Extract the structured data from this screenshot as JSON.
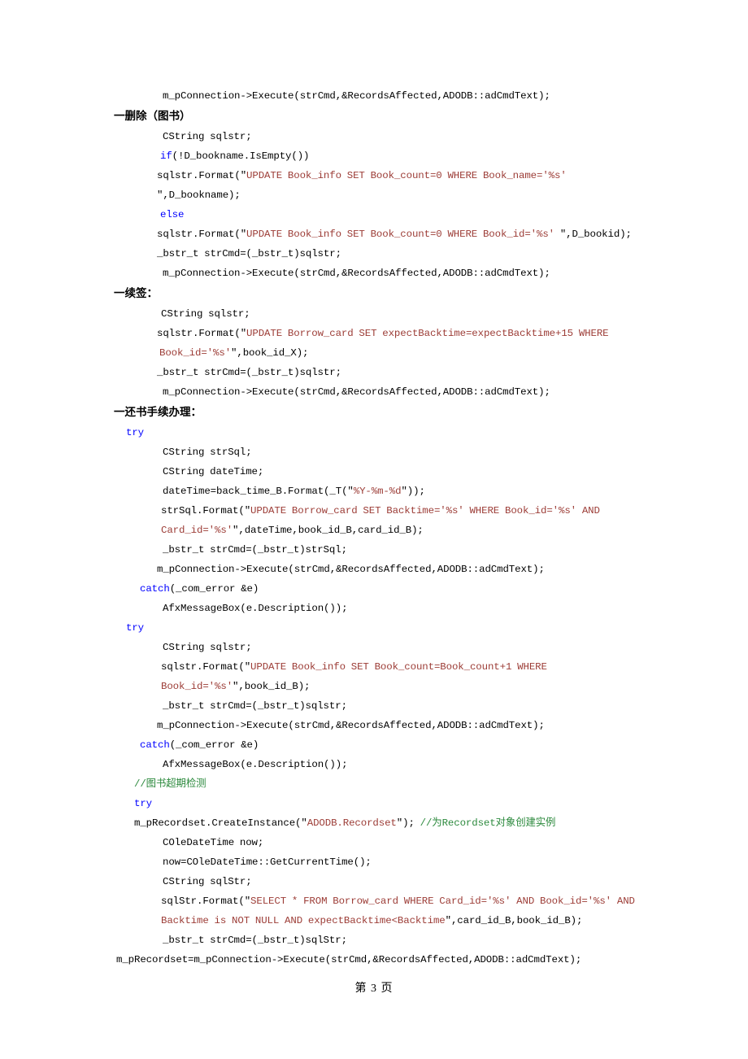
{
  "document": {
    "page_footer": "第 3 页",
    "colors": {
      "keyword": "#0000ff",
      "sql_string": "#9c3c36",
      "comment": "#2d8a3e",
      "text": "#000000"
    }
  },
  "lines": [
    {
      "id": "l01",
      "indent": "i-code",
      "segments": [
        {
          "text": "m_pConnection->Execute(strCmd,&RecordsAffected,ADODB::adCmdText);",
          "style": "plain"
        }
      ]
    },
    {
      "id": "h01",
      "type": "heading",
      "text": "一删除（图书）"
    },
    {
      "id": "l02",
      "indent": "i-code",
      "segments": [
        {
          "text": "CString sqlstr;",
          "style": "plain"
        }
      ]
    },
    {
      "id": "l03",
      "indent": "i-if",
      "segments": [
        {
          "text": "if",
          "style": "kw"
        },
        {
          "text": "(!D_bookname.IsEmpty())",
          "style": "plain"
        }
      ]
    },
    {
      "id": "l04",
      "indent": "i-sql",
      "segments": [
        {
          "text": "sqlstr.Format(″",
          "style": "plain"
        },
        {
          "text": "UPDATE Book_info SET Book_count=0 WHERE Book_name='%s'",
          "style": "sql"
        },
        {
          "text": " ″,D_bookname);",
          "style": "plain"
        }
      ]
    },
    {
      "id": "l05",
      "indent": "i-if",
      "segments": [
        {
          "text": "else",
          "style": "kw"
        }
      ]
    },
    {
      "id": "l06",
      "indent": "i-sql",
      "segments": [
        {
          "text": "sqlstr.Format(″",
          "style": "plain"
        },
        {
          "text": "UPDATE Book_info SET Book_count=0 WHERE Book_id='%s'",
          "style": "sql"
        },
        {
          "text": " ″,D_bookid);",
          "style": "plain"
        }
      ]
    },
    {
      "id": "l07",
      "indent": "i-sql",
      "segments": [
        {
          "text": "_bstr_t strCmd=(_bstr_t)sqlstr;",
          "style": "plain"
        }
      ]
    },
    {
      "id": "l08",
      "indent": "i-code",
      "segments": [
        {
          "text": "m_pConnection->Execute(strCmd,&RecordsAffected,ADODB::adCmdText);",
          "style": "plain"
        }
      ]
    },
    {
      "id": "h02",
      "type": "heading",
      "text": "一续签："
    },
    {
      "id": "l09",
      "indent": "i-fmt",
      "segments": [
        {
          "text": "CString sqlstr;",
          "style": "plain"
        }
      ]
    },
    {
      "id": "l10",
      "indent": "i-sql",
      "segments": [
        {
          "text": "sqlstr.Format(″",
          "style": "plain"
        },
        {
          "text": "UPDATE Borrow_card SET expectBacktime=expectBacktime+15 WHERE",
          "style": "sql"
        }
      ]
    },
    {
      "id": "l11",
      "indent": "i-cont",
      "segments": [
        {
          "text": "Book_id='%s'",
          "style": "sql"
        },
        {
          "text": "″,book_id_X);",
          "style": "plain"
        }
      ]
    },
    {
      "id": "l12",
      "indent": "i-sql",
      "segments": [
        {
          "text": "_bstr_t strCmd=(_bstr_t)sqlstr;",
          "style": "plain"
        }
      ]
    },
    {
      "id": "l13",
      "indent": "i-code",
      "segments": [
        {
          "text": "m_pConnection->Execute(strCmd,&RecordsAffected,ADODB::adCmdText);",
          "style": "plain"
        }
      ]
    },
    {
      "id": "h03",
      "type": "heading",
      "text": "一还书手续办理："
    },
    {
      "id": "l14",
      "indent": "i-try",
      "segments": [
        {
          "text": "try",
          "style": "kw"
        }
      ]
    },
    {
      "id": "l15",
      "indent": "i-code",
      "segments": [
        {
          "text": "CString strSql;",
          "style": "plain"
        }
      ]
    },
    {
      "id": "l16",
      "indent": "i-code",
      "segments": [
        {
          "text": "CString dateTime;",
          "style": "plain"
        }
      ]
    },
    {
      "id": "l17",
      "indent": "i-code",
      "segments": [
        {
          "text": "dateTime=back_time_B.Format(_T(″",
          "style": "plain"
        },
        {
          "text": "%Y-%m-%d",
          "style": "sql"
        },
        {
          "text": "″));",
          "style": "plain"
        }
      ]
    },
    {
      "id": "l18",
      "indent": "i-fmt",
      "segments": [
        {
          "text": "strSql.Format(″",
          "style": "plain"
        },
        {
          "text": "UPDATE Borrow_card SET Backtime='%s' WHERE Book_id='%s' AND",
          "style": "sql"
        }
      ]
    },
    {
      "id": "l19",
      "indent": "i-fmt",
      "segments": [
        {
          "text": "Card_id='%s'",
          "style": "sql"
        },
        {
          "text": "″,dateTime,book_id_B,card_id_B);",
          "style": "plain"
        }
      ]
    },
    {
      "id": "l20",
      "indent": "i-code",
      "segments": [
        {
          "text": "_bstr_t strCmd=(_bstr_t)strSql;",
          "style": "plain"
        }
      ]
    },
    {
      "id": "l21",
      "indent": "i-sql",
      "segments": [
        {
          "text": "m_pConnection->Execute(strCmd,&RecordsAffected,ADODB::adCmdText);",
          "style": "plain"
        }
      ]
    },
    {
      "id": "l22",
      "indent": "i-catch",
      "segments": [
        {
          "text": "catch",
          "style": "kw"
        },
        {
          "text": "(_com_error &e)",
          "style": "plain"
        }
      ]
    },
    {
      "id": "l23",
      "indent": "i-code",
      "segments": [
        {
          "text": "AfxMessageBox(e.Description());",
          "style": "plain"
        }
      ]
    },
    {
      "id": "l24",
      "indent": "i-try",
      "segments": [
        {
          "text": "try",
          "style": "kw"
        }
      ]
    },
    {
      "id": "l25",
      "indent": "i-code",
      "segments": [
        {
          "text": "CString sqlstr;",
          "style": "plain"
        }
      ]
    },
    {
      "id": "l26",
      "indent": "i-fmt",
      "segments": [
        {
          "text": "sqlstr.Format(″",
          "style": "plain"
        },
        {
          "text": "UPDATE Book_info SET Book_count=Book_count+1 WHERE",
          "style": "sql"
        }
      ]
    },
    {
      "id": "l27",
      "indent": "i-fmt",
      "segments": [
        {
          "text": "Book_id='%s'",
          "style": "sql"
        },
        {
          "text": "″,book_id_B);",
          "style": "plain"
        }
      ]
    },
    {
      "id": "l28",
      "indent": "i-code",
      "segments": [
        {
          "text": "_bstr_t strCmd=(_bstr_t)sqlstr;",
          "style": "plain"
        }
      ]
    },
    {
      "id": "l29",
      "indent": "i-sql",
      "segments": [
        {
          "text": "m_pConnection->Execute(strCmd,&RecordsAffected,ADODB::adCmdText);",
          "style": "plain"
        }
      ]
    },
    {
      "id": "l30",
      "indent": "i-catch",
      "segments": [
        {
          "text": "catch",
          "style": "kw"
        },
        {
          "text": "(_com_error &e)",
          "style": "plain"
        }
      ]
    },
    {
      "id": "l31",
      "indent": "i-code",
      "segments": [
        {
          "text": "AfxMessageBox(e.Description());",
          "style": "plain"
        }
      ]
    },
    {
      "id": "l32",
      "indent": "i-cmt",
      "segments": [
        {
          "text": "//图书超期检测",
          "style": "cmt"
        }
      ]
    },
    {
      "id": "l33",
      "indent": "i-cmt",
      "segments": [
        {
          "text": "try",
          "style": "kw"
        }
      ]
    },
    {
      "id": "l34",
      "indent": "i-mrec",
      "segments": [
        {
          "text": "m_pRecordset.CreateInstance(″",
          "style": "plain"
        },
        {
          "text": "ADODB.Recordset",
          "style": "sql"
        },
        {
          "text": "″); ",
          "style": "plain"
        },
        {
          "text": "//为Recordset对象创建实例",
          "style": "cmt"
        }
      ]
    },
    {
      "id": "l35",
      "indent": "i-code",
      "segments": [
        {
          "text": "COleDateTime now;",
          "style": "plain"
        }
      ]
    },
    {
      "id": "l36",
      "indent": "i-code",
      "segments": [
        {
          "text": "now=COleDateTime::GetCurrentTime();",
          "style": "plain"
        }
      ]
    },
    {
      "id": "l37",
      "indent": "i-code",
      "segments": [
        {
          "text": "CString sqlStr;",
          "style": "plain"
        }
      ]
    },
    {
      "id": "l38",
      "indent": "i-fmt",
      "segments": [
        {
          "text": "sqlStr.Format(″",
          "style": "plain"
        },
        {
          "text": "SELECT * FROM Borrow_card WHERE Card_id='%s' AND Book_id='%s' AND",
          "style": "sql"
        }
      ]
    },
    {
      "id": "l39",
      "indent": "i-fmt",
      "segments": [
        {
          "text": "Backtime is NOT NULL AND expectBacktime<Backtime",
          "style": "sql"
        },
        {
          "text": "″,card_id_B,book_id_B);",
          "style": "plain"
        }
      ]
    },
    {
      "id": "l40",
      "indent": "i-code",
      "segments": [
        {
          "text": "_bstr_t strCmd=(_bstr_t)sqlStr;",
          "style": "plain"
        }
      ]
    },
    {
      "id": "l41",
      "indent": "i-neg",
      "segments": [
        {
          "text": "m_pRecordset=m_pConnection->Execute(strCmd,&RecordsAffected,ADODB::adCmdText);",
          "style": "plain"
        }
      ]
    }
  ]
}
